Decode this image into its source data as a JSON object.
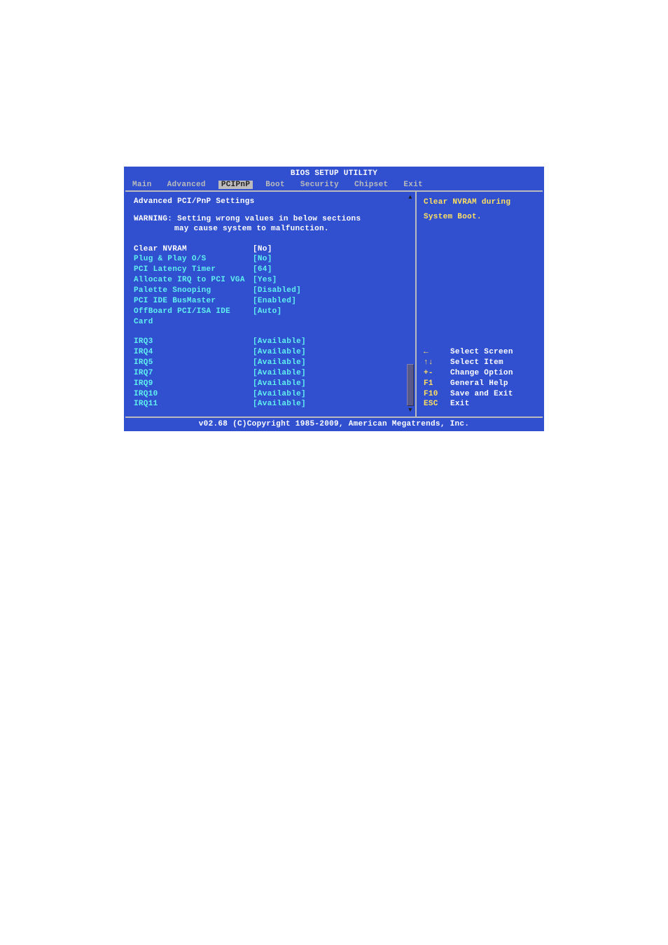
{
  "title": "BIOS SETUP UTILITY",
  "menu": {
    "items": [
      "Main",
      "Advanced",
      "PCIPnP",
      "Boot",
      "Security",
      "Chipset",
      "Exit"
    ],
    "active_index": 2
  },
  "left": {
    "heading": "Advanced PCI/PnP Settings",
    "warning_line1": "WARNING: Setting wrong values in below sections",
    "warning_line2": "may cause system to malfunction.",
    "group1": [
      {
        "label": "Clear NVRAM",
        "value": "[No]",
        "selected": true
      },
      {
        "label": "Plug & Play O/S",
        "value": "[No]"
      },
      {
        "label": "PCI Latency Timer",
        "value": "[64]"
      },
      {
        "label": "Allocate IRQ to PCI VGA",
        "value": "[Yes]"
      },
      {
        "label": "Palette Snooping",
        "value": "[Disabled]"
      },
      {
        "label": "PCI IDE BusMaster",
        "value": "[Enabled]"
      },
      {
        "label": "OffBoard PCI/ISA IDE Card",
        "value": "[Auto]"
      }
    ],
    "group2": [
      {
        "label": "IRQ3",
        "value": "[Available]"
      },
      {
        "label": "IRQ4",
        "value": "[Available]"
      },
      {
        "label": "IRQ5",
        "value": "[Available]"
      },
      {
        "label": "IRQ7",
        "value": "[Available]"
      },
      {
        "label": "IRQ9",
        "value": "[Available]"
      },
      {
        "label": "IRQ10",
        "value": "[Available]"
      },
      {
        "label": "IRQ11",
        "value": "[Available]"
      }
    ]
  },
  "right": {
    "help1": "Clear NVRAM during",
    "help2": "System Boot.",
    "keys": [
      {
        "key": "←",
        "desc": "Select Screen"
      },
      {
        "key": "↑↓",
        "desc": "Select Item"
      },
      {
        "key": "+-",
        "desc": "Change Option"
      },
      {
        "key": "F1",
        "desc": "General Help"
      },
      {
        "key": "F10",
        "desc": "Save and Exit"
      },
      {
        "key": "ESC",
        "desc": "Exit"
      }
    ]
  },
  "footer": "v02.68 (C)Copyright 1985-2009, American Megatrends, Inc."
}
